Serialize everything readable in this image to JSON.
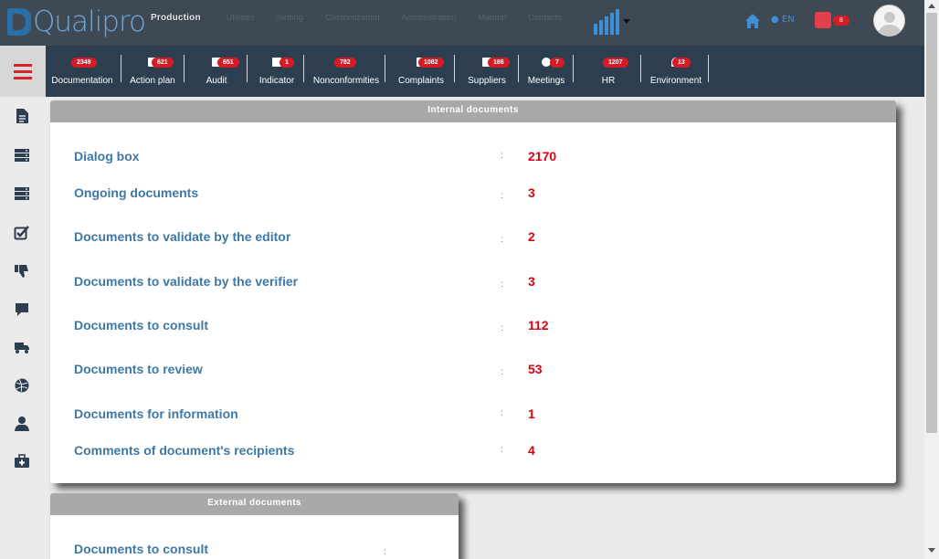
{
  "app": {
    "logo_text": "Qualipro"
  },
  "topmenu": [
    {
      "label": "Production",
      "active": true
    },
    {
      "label": "Utilities"
    },
    {
      "label": "Setting"
    },
    {
      "label": "Customization"
    },
    {
      "label": "Administration"
    },
    {
      "label": "Manual"
    },
    {
      "label": "Contacts"
    }
  ],
  "header": {
    "language": "EN",
    "users_badge": "8"
  },
  "modules": [
    {
      "label": "Documentation",
      "badge": "2349",
      "icon": "document-icon"
    },
    {
      "label": "Action plan",
      "badge": "621",
      "icon": "list-icon"
    },
    {
      "label": "Audit",
      "badge": "651",
      "icon": "checkbox-icon"
    },
    {
      "label": "Indicator",
      "badge": "1",
      "icon": "area-chart-icon"
    },
    {
      "label": "Nonconformities",
      "badge": "782",
      "icon": "thumbs-down-icon"
    },
    {
      "label": "Complaints",
      "badge": "1082",
      "icon": "comment-icon"
    },
    {
      "label": "Suppliers",
      "badge": "186",
      "icon": "truck-icon"
    },
    {
      "label": "Meetings",
      "badge": "7",
      "icon": "dribbble-icon"
    },
    {
      "label": "HR",
      "badge": "1207",
      "icon": "user-icon"
    },
    {
      "label": "Environment",
      "badge": "13",
      "icon": "bell-icon"
    }
  ],
  "sidebar": [
    {
      "icon": "document-icon"
    },
    {
      "icon": "server-icon"
    },
    {
      "icon": "server-icon"
    },
    {
      "icon": "checkbox-icon"
    },
    {
      "icon": "thumbs-down-icon"
    },
    {
      "icon": "comment-icon"
    },
    {
      "icon": "truck-icon"
    },
    {
      "icon": "dribbble-icon"
    },
    {
      "icon": "user-icon"
    },
    {
      "icon": "medkit-icon"
    }
  ],
  "internal": {
    "title": "Internal documents",
    "rows": [
      {
        "label": "Dialog box",
        "value": "2170"
      },
      {
        "label": "Ongoing documents",
        "value": "3"
      },
      {
        "label": "Documents to validate by the editor",
        "value": "2"
      },
      {
        "label": "Documents to validate by the verifier",
        "value": "3"
      },
      {
        "label": "Documents to consult",
        "value": "112"
      },
      {
        "label": "Documents to review",
        "value": "53"
      },
      {
        "label": "Documents for information",
        "value": "1"
      },
      {
        "label": "Comments of document's recipients",
        "value": "4"
      }
    ]
  },
  "external": {
    "title": "External documents",
    "rows": [
      {
        "label": "Documents to consult",
        "value": ""
      }
    ]
  },
  "colors": {
    "accent": "#3e78a5",
    "value": "#e0000d",
    "badge": "#d61b26",
    "topbar": "#3f4954",
    "modbar": "#2d3e50"
  }
}
